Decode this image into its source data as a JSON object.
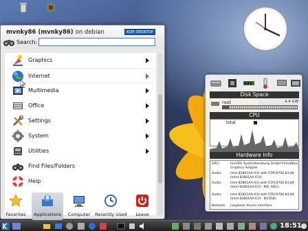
{
  "launcher": {
    "user_name": "mvnky86 (mvnky86)",
    "host_text": "on debian",
    "kde_badge": "KDE DESKTOP",
    "search_label": "Search:",
    "search_value": "",
    "items": [
      {
        "label": "Graphics",
        "icon": "graphics-icon"
      },
      {
        "label": "Internet",
        "icon": "internet-globe-icon"
      },
      {
        "label": "Multimedia",
        "icon": "multimedia-icon"
      },
      {
        "label": "Office",
        "icon": "office-icon"
      },
      {
        "label": "Settings",
        "icon": "settings-tools-icon"
      },
      {
        "label": "System",
        "icon": "system-gear-icon"
      },
      {
        "label": "Utilities",
        "icon": "utilities-icon"
      },
      {
        "label": "Find Files/Folders",
        "icon": "binoculars-icon"
      },
      {
        "label": "Help",
        "icon": "help-lifebuoy-icon"
      }
    ],
    "active_item": "Internet",
    "tabs": [
      {
        "label": "Favorites",
        "icon": "star-icon"
      },
      {
        "label": "Applications",
        "icon": "applications-icon"
      },
      {
        "label": "Computer",
        "icon": "computer-icon"
      },
      {
        "label": "Recently Used",
        "icon": "clock-icon"
      },
      {
        "label": "Leave",
        "icon": "power-icon"
      }
    ],
    "active_tab": "Applications"
  },
  "sysmon": {
    "disk_title": "Disk Space",
    "disk_label": "root",
    "disk_size": "4.4 GiB",
    "disk_used_fraction": 0.08,
    "cpu_title": "CPU",
    "cpu_total_label": "total",
    "hw_title": "Hardware Info",
    "hw_rows": [
      {
        "key": "GPU:",
        "value": "InnoTek Systemberatung GmbH VirtualBox Graphics Adapter"
      },
      {
        "key": "Audio:",
        "value": "Intel 82801AA-ICH with STAC9700,83,84 (Intel 82801AA-ICH)"
      },
      {
        "key": "Audio:",
        "value": "Intel 82801AA-ICH with STAC9700,83,84 (Intel 82801AA-ICH - MIC ADC)"
      },
      {
        "key": "Audio:",
        "value": "Intel 82801AA-ICH with STAC9700,83,84 (Intel 82801AA-ICH - IEC958)"
      },
      {
        "key": "Network:",
        "value": "Loopback device Interface"
      }
    ]
  },
  "taskbar": {
    "time": "18:51"
  },
  "colors": {
    "accent": "#3b79c7",
    "taskbar": "#2a2a2a",
    "flower_petal": "#f5b81a"
  }
}
